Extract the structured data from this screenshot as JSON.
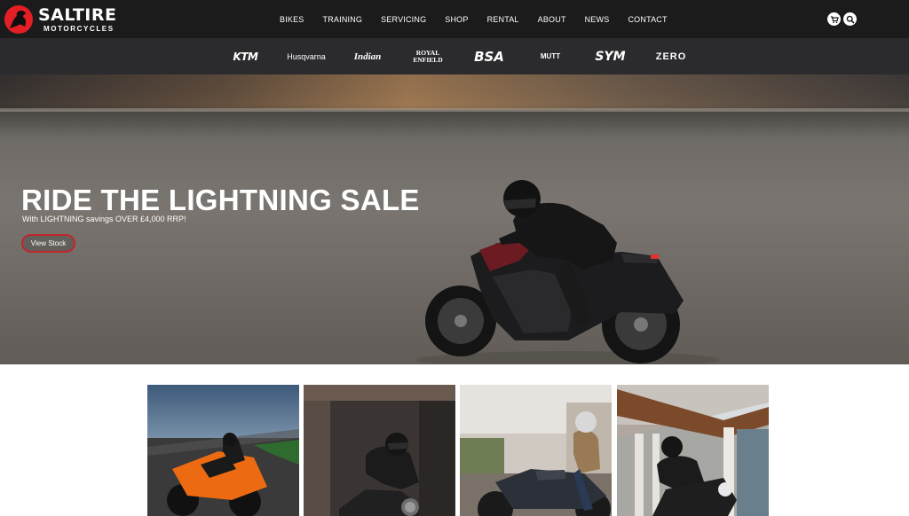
{
  "header": {
    "logo": {
      "title": "SALTIRE",
      "subtitle": "MOTORCYCLES"
    },
    "nav": [
      "BIKES",
      "TRAINING",
      "SERVICING",
      "SHOP",
      "RENTAL",
      "ABOUT",
      "NEWS",
      "CONTACT"
    ],
    "icons": [
      "cart-icon",
      "search-icon"
    ]
  },
  "brands": [
    "KTM",
    "Husqvarna",
    "Indian",
    "ROYAL ENFIELD",
    "BSA",
    "MUTT",
    "SYM",
    "ZERO"
  ],
  "hero": {
    "title": "RIDE THE LIGHTNING SALE",
    "subtitle": "With LIGHTNING savings OVER £4,000 RRP!",
    "button": "View Stock"
  }
}
